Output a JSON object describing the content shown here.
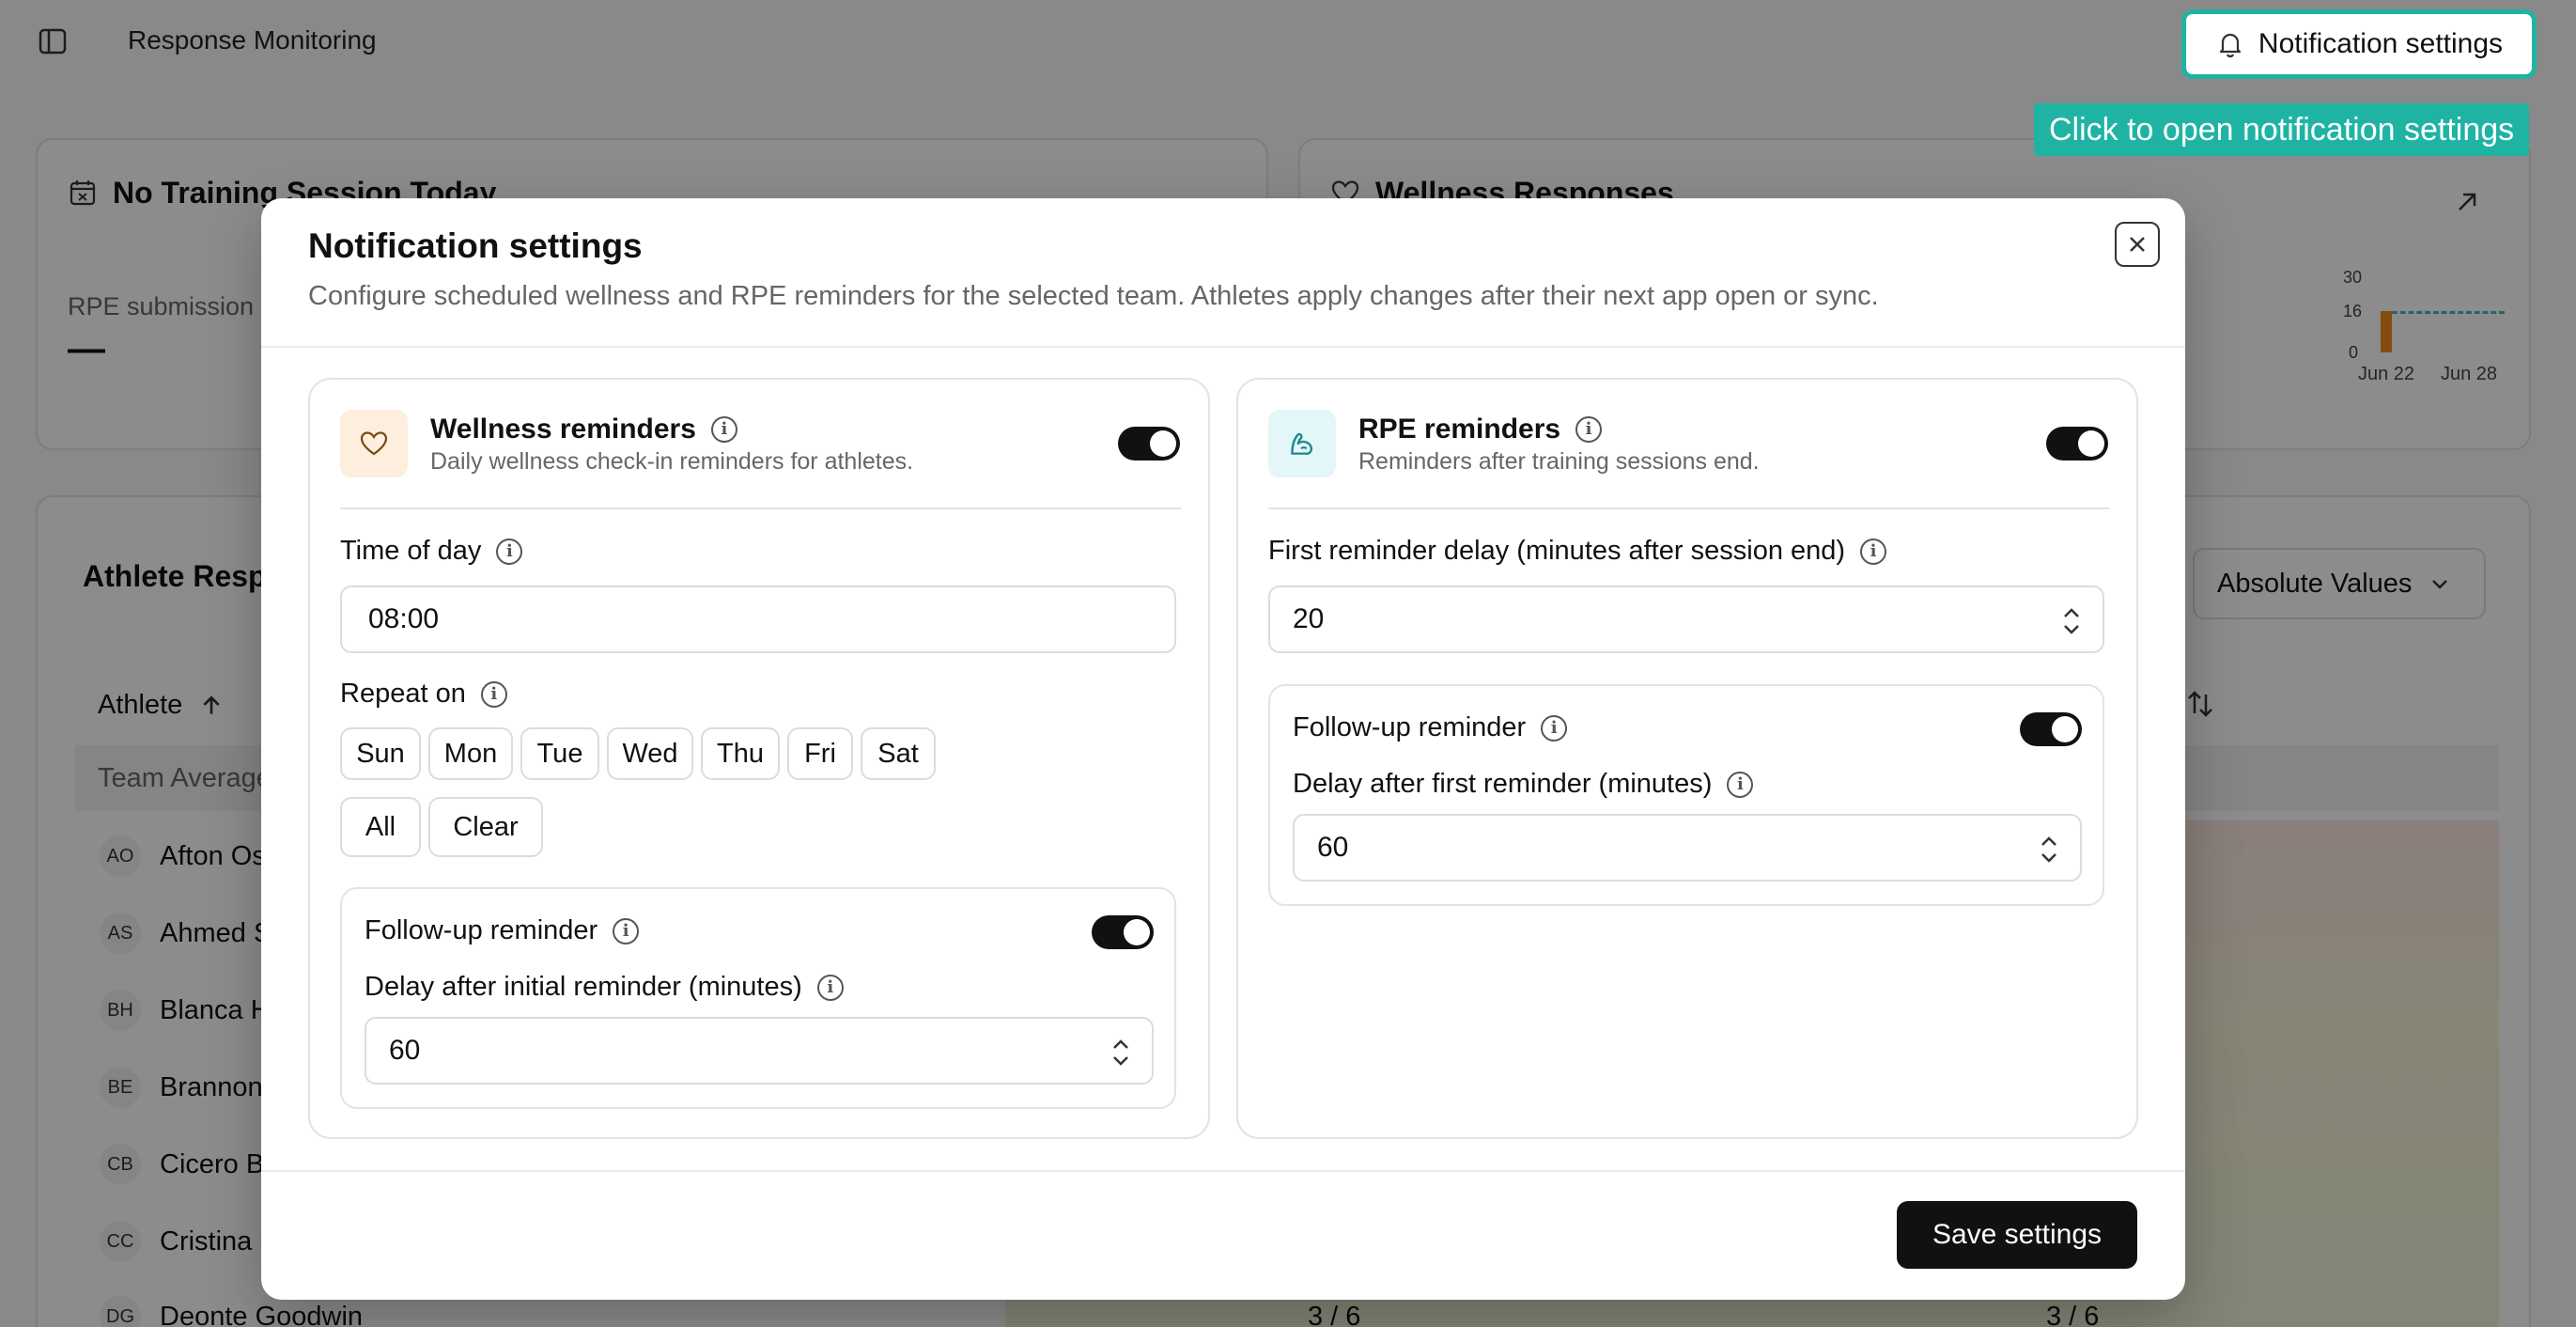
{
  "app": {
    "title": "Response Monitoring"
  },
  "header": {
    "notification_button": "Notification settings"
  },
  "tooltip": {
    "text": "Click to open notification settings"
  },
  "background": {
    "training_card": {
      "title": "No Training Session Today",
      "subtitle": "RPE submission",
      "value": "—"
    },
    "wellness_card": {
      "title": "Wellness Responses",
      "chart_ticks": [
        "30",
        "16",
        "0"
      ],
      "chart_dates": [
        "Jun 22",
        "Jun 28"
      ]
    },
    "athlete_card": {
      "title": "Athlete Resp",
      "view_select": "Absolute Values",
      "column_athlete": "Athlete",
      "team_average": "Team Average",
      "rows": [
        {
          "initials": "AO",
          "name": "Afton Os"
        },
        {
          "initials": "AS",
          "name": "Ahmed S"
        },
        {
          "initials": "BH",
          "name": "Blanca H"
        },
        {
          "initials": "BE",
          "name": "Brannon"
        },
        {
          "initials": "CB",
          "name": "Cicero Bo"
        },
        {
          "initials": "CC",
          "name": "Cristina C"
        },
        {
          "initials": "DG",
          "name": "Deonte Goodwin",
          "score1": "3 / 6",
          "score2": "3 / 6"
        }
      ]
    }
  },
  "modal": {
    "title": "Notification settings",
    "description": "Configure scheduled wellness and RPE reminders for the selected team. Athletes apply changes after their next app open or sync.",
    "wellness": {
      "title": "Wellness reminders",
      "subtitle": "Daily wellness check-in reminders for athletes.",
      "enabled": true,
      "time_label": "Time of day",
      "time_value": "08:00",
      "repeat_label": "Repeat on",
      "days": [
        "Sun",
        "Mon",
        "Tue",
        "Wed",
        "Thu",
        "Fri",
        "Sat"
      ],
      "all_label": "All",
      "clear_label": "Clear",
      "followup_label": "Follow-up reminder",
      "followup_enabled": true,
      "delay_label": "Delay after initial reminder (minutes)",
      "delay_value": "60"
    },
    "rpe": {
      "title": "RPE reminders",
      "subtitle": "Reminders after training sessions end.",
      "enabled": true,
      "first_delay_label": "First reminder delay (minutes after session end)",
      "first_delay_value": "20",
      "followup_label": "Follow-up reminder",
      "followup_enabled": true,
      "delay_label": "Delay after first reminder (minutes)",
      "delay_value": "60"
    },
    "save_label": "Save settings"
  },
  "colors": {
    "accent": "#1fb3a4",
    "wellness_icon_bg": "#fdeedd",
    "rpe_icon_bg": "#e3f6f8"
  }
}
